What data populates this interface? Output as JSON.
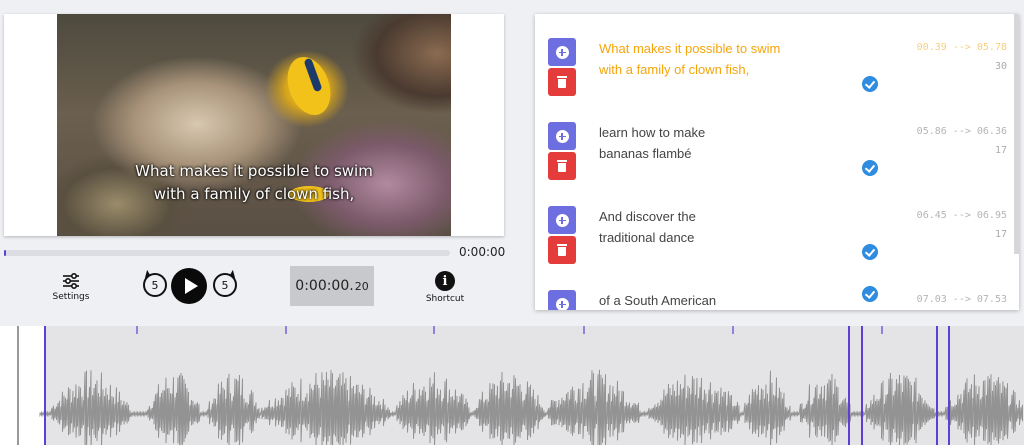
{
  "player": {
    "subtitle_line1": "What makes it possible to swim",
    "subtitle_line2": "with a family of clown fish,",
    "current_time": "0:00:00",
    "progress": 0.005,
    "timecode_main": "0:00:00.",
    "timecode_ms": "20",
    "settings_label": "Settings",
    "shortcut_label": "Shortcut",
    "skip_back": "5",
    "skip_forward": "5"
  },
  "subtitles": [
    {
      "line1": "What makes it possible to swim",
      "line2": "with a family of clown fish,",
      "start": "00.39",
      "end": "05.78",
      "extra": "30",
      "active": true
    },
    {
      "line1": "learn how to make",
      "line2": "bananas flambé",
      "start": "05.86",
      "end": "06.36",
      "extra": "17",
      "active": false
    },
    {
      "line1": "And discover the",
      "line2": "traditional dance",
      "start": "06.45",
      "end": "06.95",
      "extra": "17",
      "active": false
    },
    {
      "line1": "of a South American",
      "line2": "",
      "start": "07.03",
      "end": "07.53",
      "extra": "",
      "active": false
    }
  ],
  "colors": {
    "accent": "#5b3fd6",
    "add_button": "#6d6ee0",
    "delete_button": "#e43b3b",
    "active_text": "#f5a50a",
    "check": "#2f8ce0",
    "wave": "#939393"
  }
}
